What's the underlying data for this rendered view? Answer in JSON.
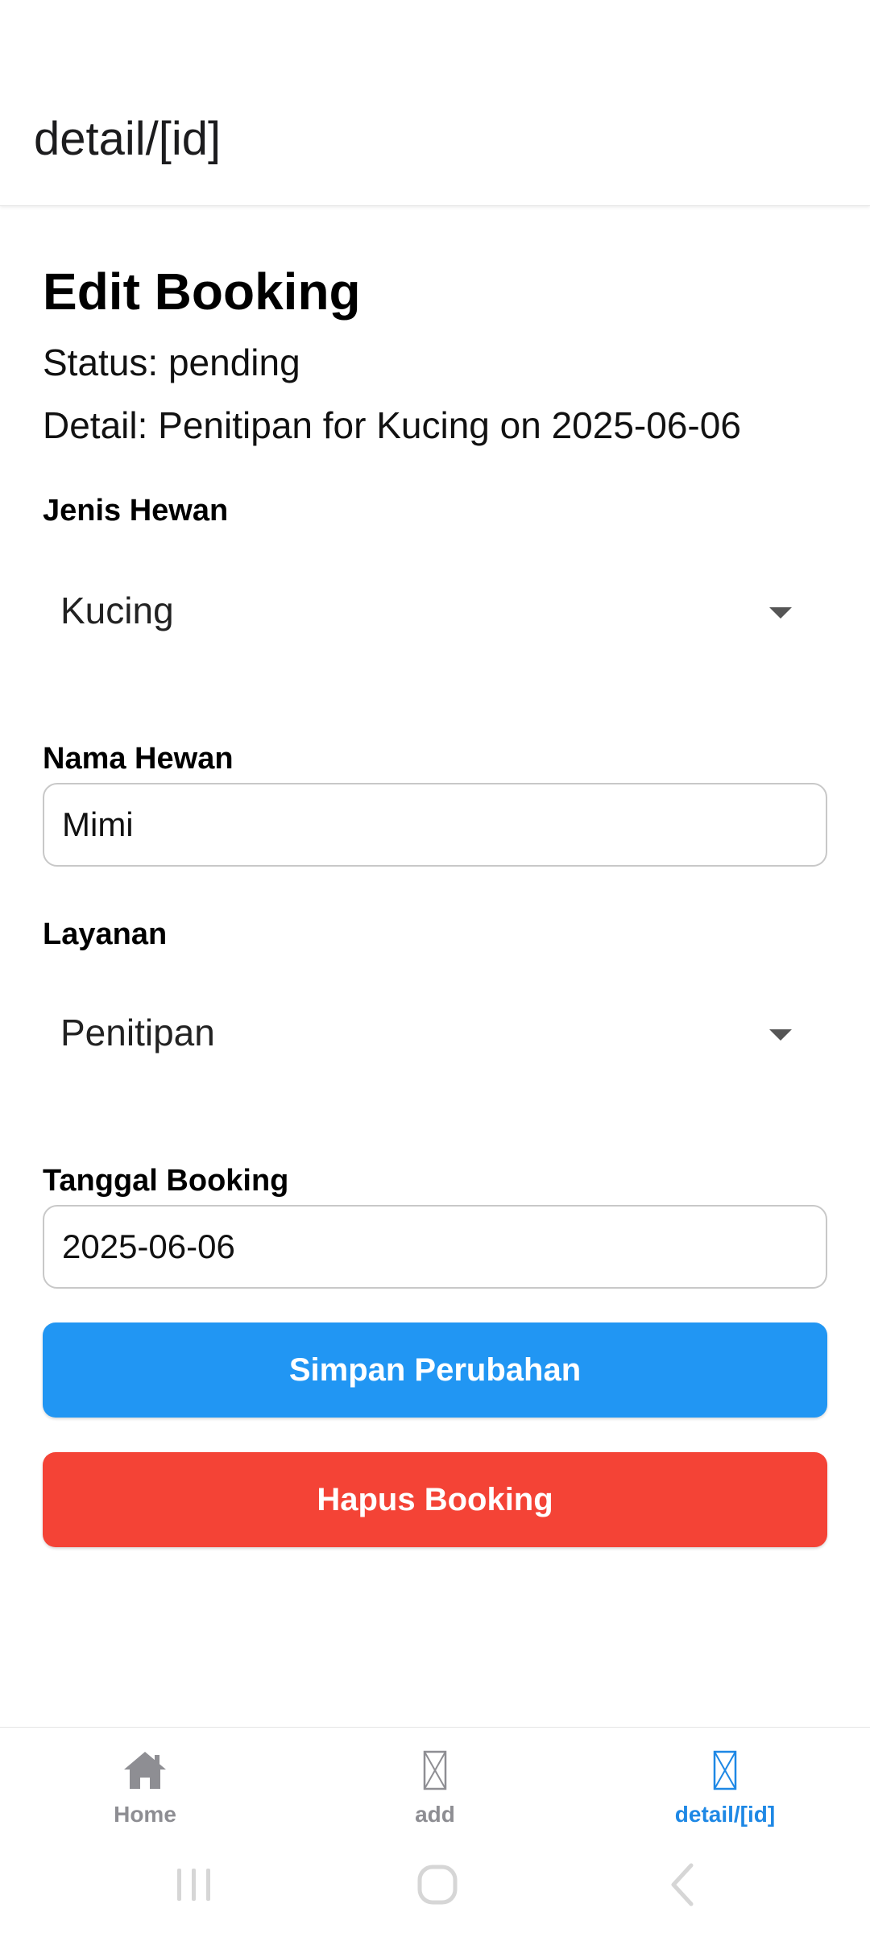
{
  "header": {
    "title": "detail/[id]"
  },
  "page": {
    "title": "Edit Booking",
    "status": "Status: pending",
    "detail": "Detail: Penitipan for Kucing on 2025-06-06"
  },
  "form": {
    "jenis_hewan": {
      "label": "Jenis Hewan",
      "value": "Kucing"
    },
    "nama_hewan": {
      "label": "Nama Hewan",
      "value": "Mimi"
    },
    "layanan": {
      "label": "Layanan",
      "value": "Penitipan"
    },
    "tanggal_booking": {
      "label": "Tanggal Booking",
      "value": "2025-06-06"
    }
  },
  "buttons": {
    "save_label": "Simpan Perubahan",
    "delete_label": "Hapus Booking"
  },
  "tabs": [
    {
      "label": "Home",
      "icon": "home-icon",
      "active": false
    },
    {
      "label": "add",
      "icon": "missing-glyph-icon",
      "active": false
    },
    {
      "label": "detail/[id]",
      "icon": "missing-glyph-icon",
      "active": true
    }
  ],
  "colors": {
    "primary": "#2196f3",
    "danger": "#f44336",
    "active_tab": "#1e88e5",
    "inactive_tab": "#8e8e93"
  }
}
